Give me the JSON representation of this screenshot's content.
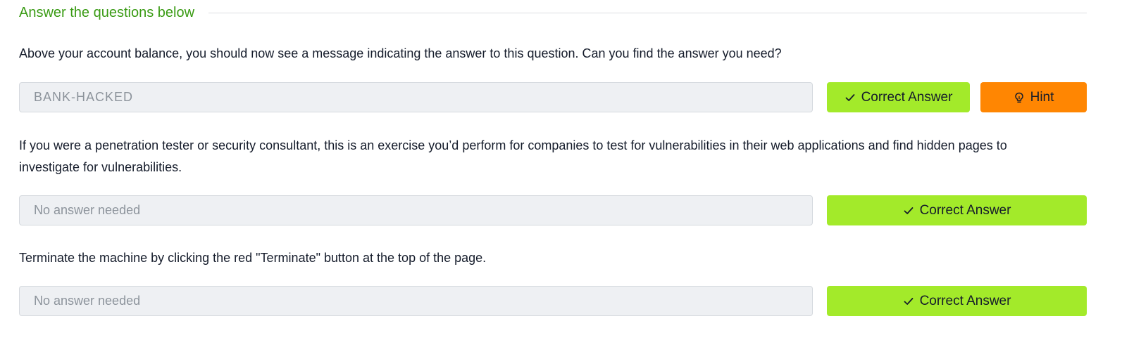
{
  "section": {
    "title": "Answer the questions below"
  },
  "questions": [
    {
      "text": "Above your account balance, you should now see a message indicating the answer to this question. Can you find the answer you need?",
      "answer_value": "BANK-HACKED",
      "answer_placeholder": "",
      "submit_label": "Correct Answer",
      "hint_label": "Hint",
      "submit_icon": "check-icon",
      "hint_icon": "lightbulb-icon"
    },
    {
      "text": "If you were a penetration tester or security consultant, this is an exercise you’d perform for companies to test for vulnerabilities in their web applications and find hidden pages to investigate for vulnerabilities.",
      "answer_value": "",
      "answer_placeholder": "No answer needed",
      "submit_label": "Correct Answer",
      "submit_icon": "check-icon"
    },
    {
      "text": "Terminate the machine by clicking the red \"Terminate\" button at the top of the page.",
      "answer_value": "",
      "answer_placeholder": "No answer needed",
      "submit_label": "Correct Answer",
      "submit_icon": "check-icon"
    }
  ],
  "colors": {
    "section_title": "#3a9b14",
    "correct_button": "#a3ea2a",
    "hint_button": "#ff8602",
    "input_background": "#eef0f3",
    "text": "#151c2b"
  }
}
